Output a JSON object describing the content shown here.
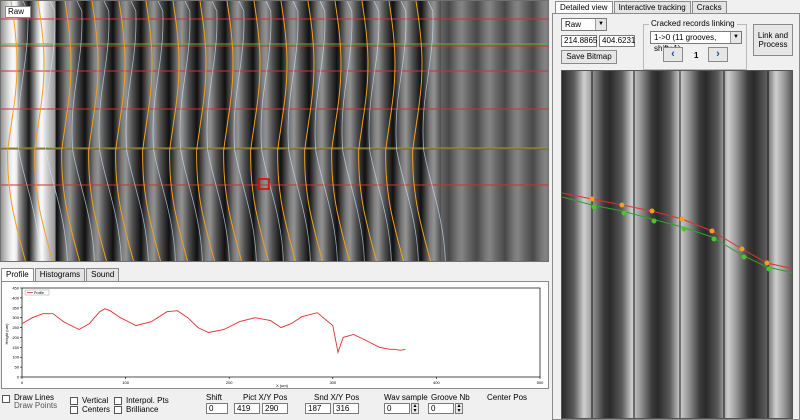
{
  "main_view": {
    "mode_label": "Raw"
  },
  "profile_tabs": [
    "Profile",
    "Histograms",
    "Sound"
  ],
  "plot": {
    "legend": "Profile",
    "y_ticks": [
      "450",
      "400",
      "350",
      "300",
      "250",
      "200",
      "150",
      "100",
      "50",
      "0"
    ],
    "x_ticks": [
      "0",
      "100",
      "200",
      "300",
      "400",
      "500"
    ],
    "ylabel": "Height (um)",
    "xlabel": "X (um)",
    "line_color": "#e03030"
  },
  "chart_data": {
    "type": "line",
    "title": "",
    "xlabel": "X (um)",
    "ylabel": "Height (um)",
    "xlim": [
      0,
      500
    ],
    "ylim": [
      0,
      450
    ],
    "legend": "top-left",
    "grid": false,
    "series": [
      {
        "name": "Profile",
        "x": [
          0,
          10,
          20,
          30,
          40,
          55,
          65,
          75,
          80,
          85,
          95,
          110,
          125,
          140,
          150,
          160,
          170,
          180,
          195,
          210,
          225,
          240,
          250,
          260,
          270,
          285,
          300,
          305,
          310,
          320,
          330,
          345,
          355,
          360,
          365,
          370
        ],
        "values": [
          270,
          300,
          320,
          320,
          280,
          240,
          270,
          330,
          345,
          335,
          300,
          260,
          280,
          330,
          335,
          300,
          250,
          225,
          240,
          280,
          300,
          285,
          250,
          270,
          305,
          325,
          260,
          125,
          200,
          215,
          190,
          150,
          140,
          140,
          135,
          140
        ]
      }
    ]
  },
  "bottom": {
    "draw_lines": "Draw Lines",
    "draw_points": "Draw Points",
    "vertical": "Vertical",
    "centers": "Centers",
    "interpol_pts": "Interpol. Pts",
    "brilliance": "Brilliance",
    "shift_label": "Shift",
    "shift_value": "0",
    "pict_label": "Pict X/Y Pos",
    "pict_x": "419",
    "pict_y": "290",
    "snd_label": "Snd X/Y Pos",
    "snd_x": "187",
    "snd_y": "316",
    "wav_label": "Wav sample",
    "wav_value": "0",
    "groove_label": "Groove Nb",
    "groove_value": "0",
    "center_label": "Center Pos"
  },
  "right_tabs": [
    "Detailed view",
    "Interactive tracking",
    "Cracks"
  ],
  "right": {
    "mode": "Raw",
    "coord_x": "214.8865",
    "coord_y": "404.6231",
    "save_bitmap": "Save Bitmap",
    "group_label": "Cracked records linking",
    "link_select": "1->0 (11 grooves, shift+1)",
    "page": "1",
    "link_process_line1": "Link and",
    "link_process_line2": "Process"
  }
}
